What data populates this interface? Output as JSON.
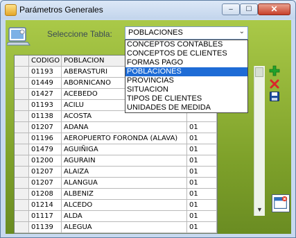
{
  "window": {
    "title": "Parámetros Generales"
  },
  "title_buttons": {
    "minimize": "‒",
    "maximize": "☐",
    "close": "✕"
  },
  "form": {
    "label": "Seleccione Tabla:",
    "selected": "POBLACIONES",
    "options": [
      "CONCEPTOS CONTABLES",
      "CONCEPTOS DE CLIENTES",
      "FORMAS PAGO",
      "POBLACIONES",
      "PROVINCIAS",
      "SITUACION",
      "TIPOS DE CLIENTES",
      "UNIDADES DE MEDIDA"
    ]
  },
  "grid": {
    "columns": [
      "CODIGO",
      "POBLACION"
    ],
    "rows": [
      {
        "codigo": "01193",
        "poblacion": "ABERASTURI",
        "extra": ""
      },
      {
        "codigo": "01449",
        "poblacion": "ABORNICANO",
        "extra": ""
      },
      {
        "codigo": "01427",
        "poblacion": "ACEBEDO",
        "extra": ""
      },
      {
        "codigo": "01193",
        "poblacion": "ACILU",
        "extra": ""
      },
      {
        "codigo": "01138",
        "poblacion": "ACOSTA",
        "extra": ""
      },
      {
        "codigo": "01207",
        "poblacion": "ADANA",
        "extra": "01"
      },
      {
        "codigo": "01196",
        "poblacion": "AEROPUERTO FORONDA (ALAVA)",
        "extra": "01"
      },
      {
        "codigo": "01479",
        "poblacion": "AGUIÑIGA",
        "extra": "01"
      },
      {
        "codigo": "01200",
        "poblacion": "AGURAIN",
        "extra": "01"
      },
      {
        "codigo": "01207",
        "poblacion": "ALAIZA",
        "extra": "01"
      },
      {
        "codigo": "01207",
        "poblacion": "ALANGUA",
        "extra": "01"
      },
      {
        "codigo": "01208",
        "poblacion": "ALBENIZ",
        "extra": "01"
      },
      {
        "codigo": "01214",
        "poblacion": "ALCEDO",
        "extra": "01"
      },
      {
        "codigo": "01117",
        "poblacion": "ALDA",
        "extra": "01"
      },
      {
        "codigo": "01139",
        "poblacion": "ALEGUA",
        "extra": "01"
      }
    ]
  },
  "icons": {
    "add": "plus-icon",
    "delete": "x-icon",
    "save": "floppy-icon",
    "close_form": "close-window-icon"
  },
  "colors": {
    "panel": "#7ea12a",
    "selection": "#1e6cd6",
    "add": "#21a32b",
    "delete": "#d9262b",
    "save": "#1f4f9e"
  }
}
